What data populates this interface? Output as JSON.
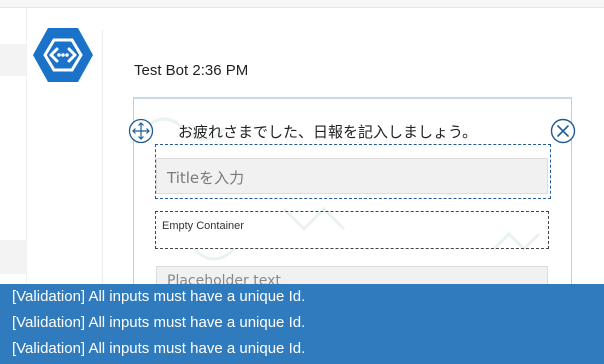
{
  "message": {
    "sender_line": "Test Bot 2:36 PM"
  },
  "card": {
    "title": "お疲れさまでした、日報を記入しましょう。",
    "title_input_placeholder": "Titleを入力",
    "empty_container_label": "Empty Container",
    "placeholder_input_text": "Placeholder text"
  },
  "validation": {
    "messages": [
      "[Validation] All inputs must have a unique Id.",
      "[Validation] All inputs must have a unique Id.",
      "[Validation] All inputs must have a unique Id."
    ]
  },
  "icons": {
    "avatar": "bot-hexagon-icon",
    "move": "move-arrows-icon",
    "close": "close-circle-icon"
  },
  "colors": {
    "brand": "#1a73c8",
    "validation_bar": "#2f7bbd",
    "selection_border": "#1f5c94"
  }
}
